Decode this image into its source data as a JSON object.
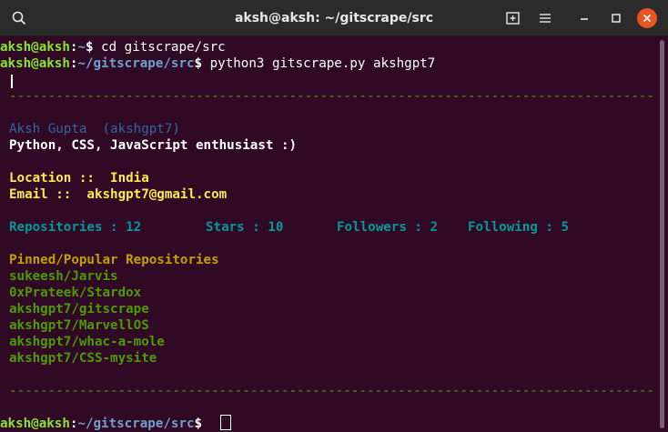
{
  "window": {
    "title": "aksh@aksh: ~/gitscrape/src",
    "icons": [
      "search-icon",
      "new-tab-icon",
      "menu-icon",
      "minimize-icon",
      "maximize-icon",
      "close-icon"
    ]
  },
  "colors": {
    "background": "#300a24",
    "prompt_user": "#8ae234",
    "prompt_path": "#729fcf",
    "separator": "#4e9a06",
    "name": "#3465a4",
    "yellow": "#fce94f",
    "cyan": "#06989a",
    "repo_header": "#c4a000",
    "repo": "#4e9a06",
    "close": "#e95420"
  },
  "terminal": {
    "cmd1": {
      "user": "aksh@aksh",
      "colon": ":",
      "path": "~",
      "symbol": "$",
      "command": " cd gitscrape/src"
    },
    "cmd2": {
      "user": "aksh@aksh",
      "colon": ":",
      "path": "~/gitscrape/src",
      "symbol": "$",
      "command": " python3 gitscrape.py akshgpt7"
    },
    "separator": "------------------------------------------------------------------------------------",
    "name": "Aksh Gupta  (akshgpt7)",
    "bio": "Python, CSS, JavaScript enthusiast :)",
    "location": "Location ::  India",
    "email": "Email ::  akshgpt7@gmail.com",
    "stats": {
      "repositories": "Repositories : 12",
      "stars": "Stars : 10",
      "followers": "Followers : 2",
      "following": "Following : 5"
    },
    "pinned_header": "Pinned/Popular Repositories",
    "repos": [
      "sukeesh/Jarvis",
      "0xPrateek/Stardox",
      "akshgpt7/gitscrape",
      "akshgpt7/MarvellOS",
      "akshgpt7/whac-a-mole",
      "akshgpt7/CSS-mysite"
    ],
    "cmd3": {
      "user": "aksh@aksh",
      "colon": ":",
      "path": "~/gitscrape/src",
      "symbol": "$"
    }
  }
}
